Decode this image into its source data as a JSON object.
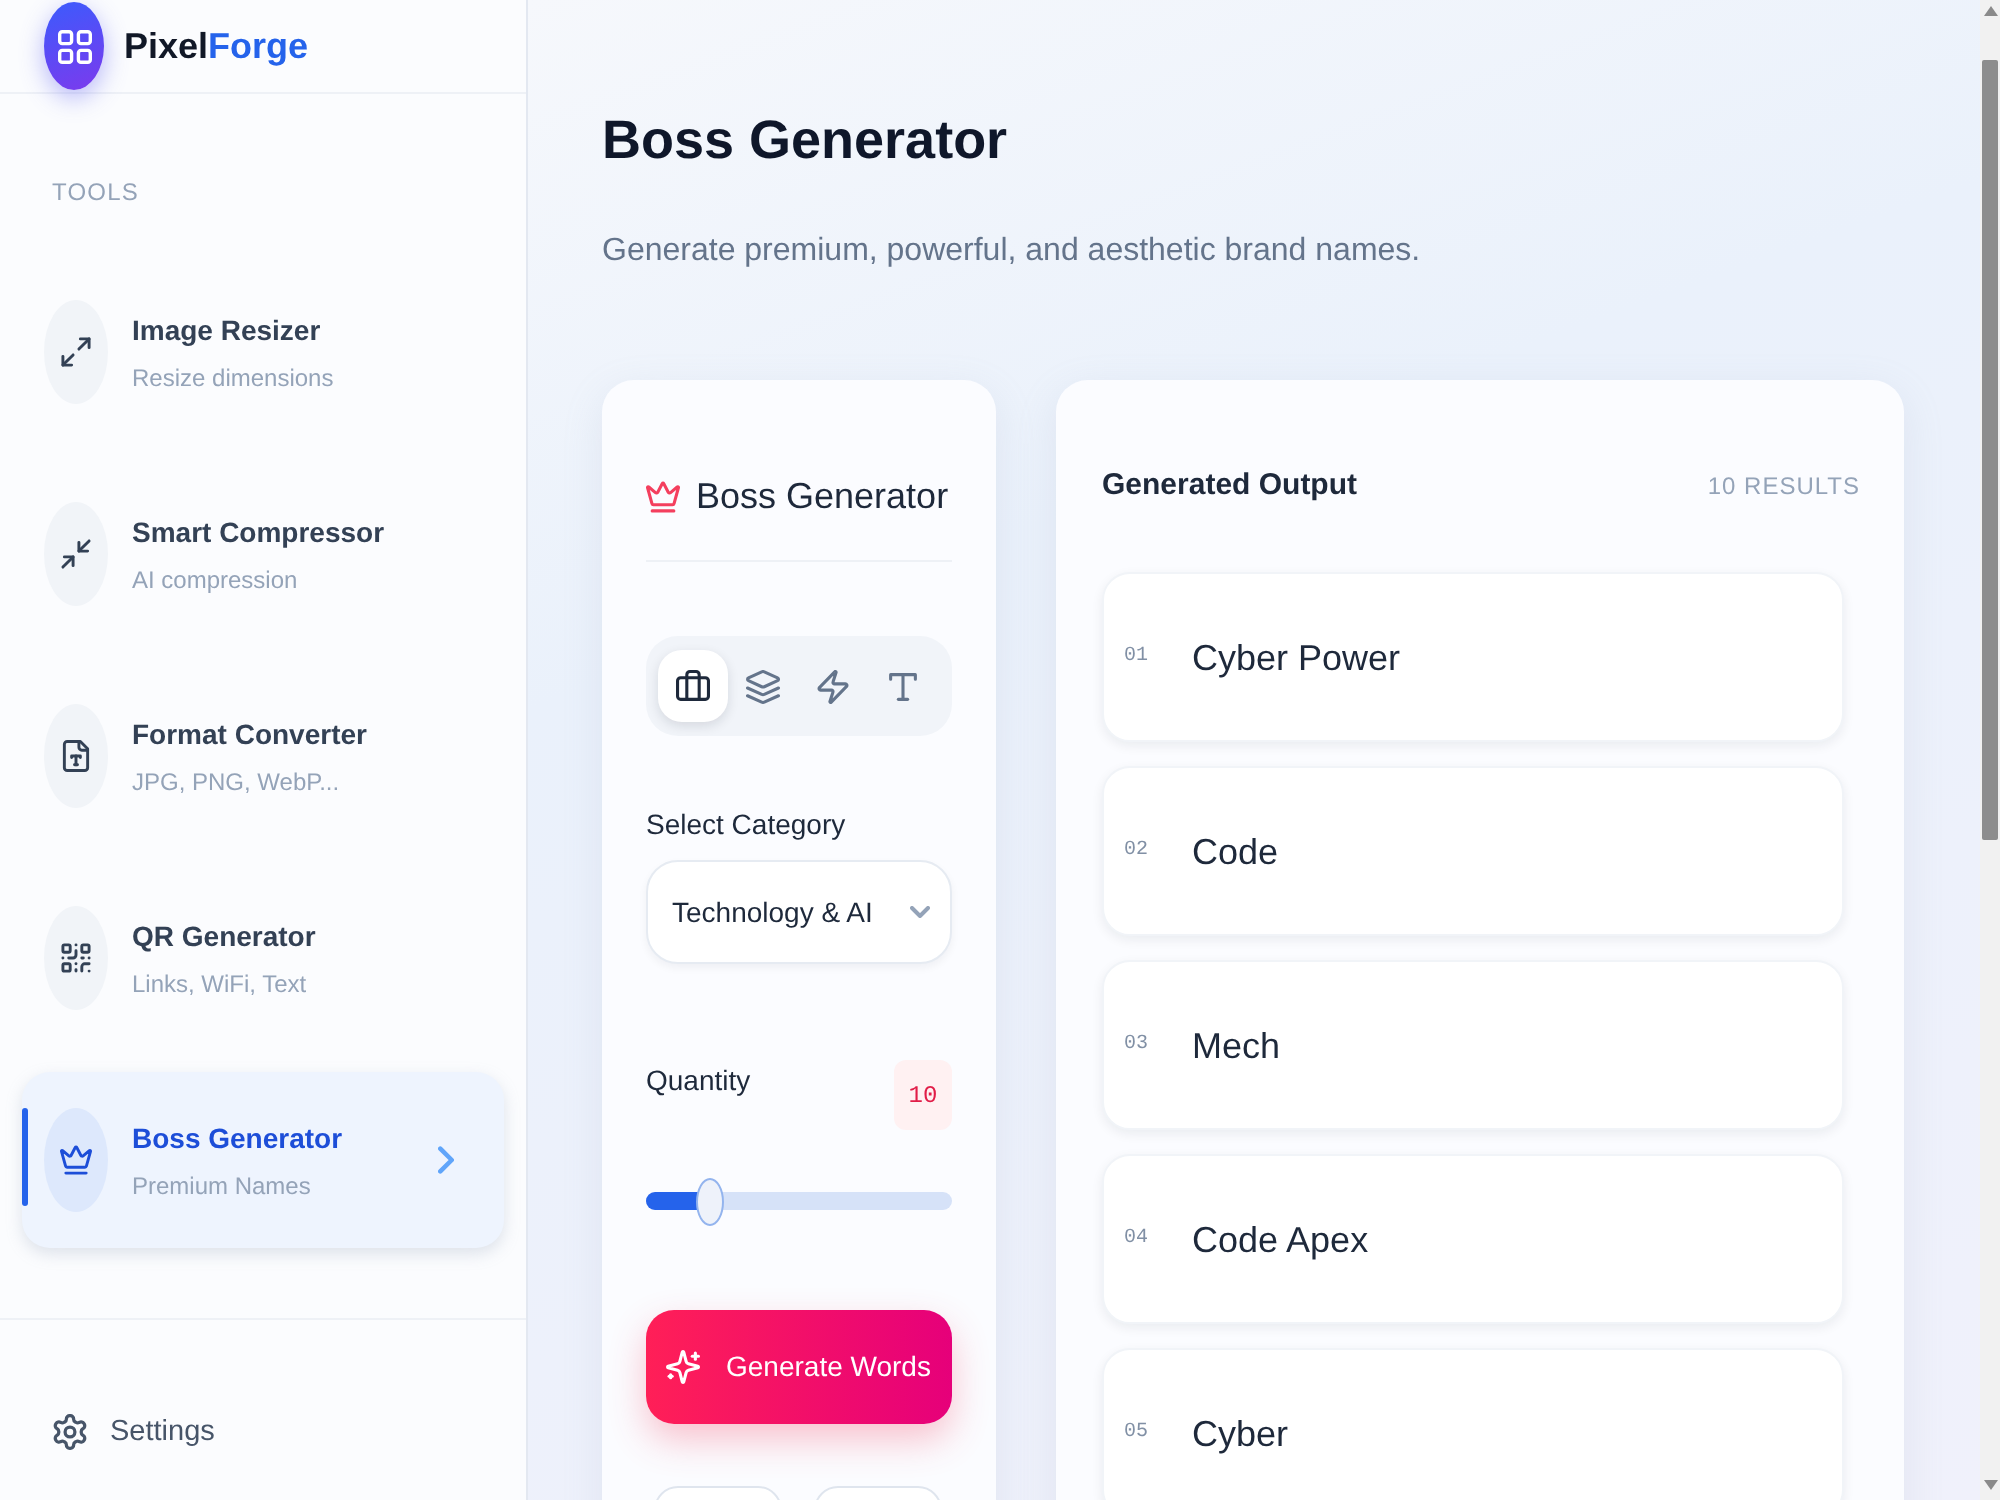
{
  "sidebar": {
    "brand_parts": [
      "Pixel",
      "Forge"
    ],
    "section": "TOOLS",
    "items": [
      {
        "title": "Image Resizer",
        "subtitle": "Resize dimensions",
        "selected": false
      },
      {
        "title": "Smart Compressor",
        "subtitle": "AI compression",
        "selected": false
      },
      {
        "title": "Format Converter",
        "subtitle": "JPG, PNG, WebP...",
        "selected": false
      },
      {
        "title": "QR Generator",
        "subtitle": "Links, WiFi, Text",
        "selected": false
      },
      {
        "title": "Boss Generator",
        "subtitle": "Premium Names",
        "selected": true
      }
    ],
    "settings": "Settings"
  },
  "page": {
    "title": "Boss Generator",
    "subtitle": "Generate premium, powerful, and aesthetic brand names."
  },
  "generator": {
    "title": "Boss Generator",
    "modes": [
      {
        "selected": true
      },
      {
        "selected": false
      },
      {
        "selected": false
      },
      {
        "selected": false
      }
    ],
    "category": {
      "label": "Select Category",
      "value": "Technology & AI"
    },
    "quantity": {
      "label": "Quantity",
      "value": "10",
      "level": 0.21
    },
    "generate_button": "Generate Words",
    "extra_buttons": [
      {
        "kind": "outline"
      },
      {
        "kind": "outline"
      }
    ]
  },
  "output": {
    "title": "Generated Output",
    "count": "10 RESULTS",
    "results": [
      {
        "number": "01",
        "name": "Cyber Power"
      },
      {
        "number": "02",
        "name": "Code"
      },
      {
        "number": "03",
        "name": "Mech"
      },
      {
        "number": "04",
        "name": "Code Apex"
      },
      {
        "number": "05",
        "name": "Cyber"
      }
    ]
  }
}
